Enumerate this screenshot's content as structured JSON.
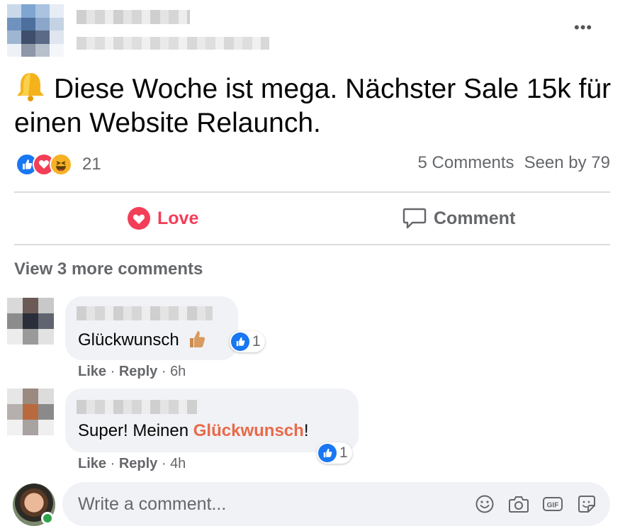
{
  "post": {
    "text": "Diese Woche ist mega. Nächster Sale 15k für einen Website Relaunch.",
    "reaction_count": "21",
    "comments_count": "5 Comments",
    "seen_by": "Seen by 79",
    "bell_icon": "bell-icon",
    "menu_icon": "more-dots-icon"
  },
  "actions": {
    "love_label": "Love",
    "comment_label": "Comment"
  },
  "view_more": "View 3 more comments",
  "comments": [
    {
      "text": "Glückwunsch",
      "emoji_icon": "thumbs-up-hand-icon",
      "reaction_count": "1",
      "like_label": "Like",
      "reply_label": "Reply",
      "time": "6h"
    },
    {
      "text_before": "Super! Meinen ",
      "text_highlight": "Glückwunsch",
      "text_after": "!",
      "reaction_count": "1",
      "like_label": "Like",
      "reply_label": "Reply",
      "time": "4h"
    }
  ],
  "composer": {
    "placeholder": "Write a comment...",
    "icons": [
      "emoji-icon",
      "camera-icon",
      "gif-icon",
      "sticker-icon"
    ]
  },
  "colors": {
    "like_blue": "#1877f2",
    "love_red": "#f33e58",
    "haha_yellow": "#f7b125",
    "highlight_orange": "#e9694a",
    "secondary_text": "#65676b",
    "online_green": "#31a24c"
  }
}
